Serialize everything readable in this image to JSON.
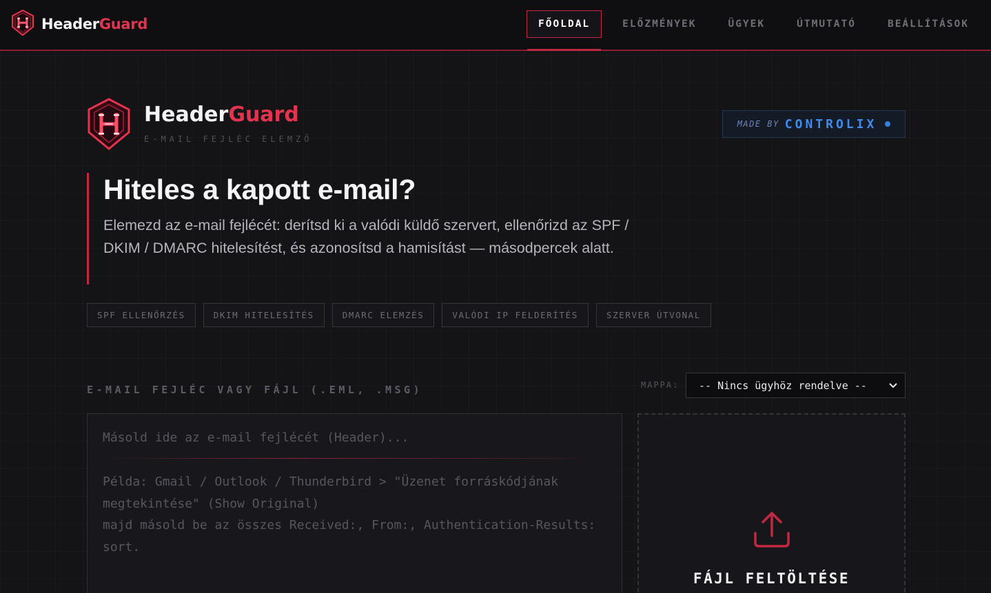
{
  "brand": {
    "name_white": "Header",
    "name_red": "Guard"
  },
  "nav": {
    "items": [
      {
        "label": "FŐOLDAL",
        "active": true
      },
      {
        "label": "ELŐZMÉNYEK",
        "active": false
      },
      {
        "label": "ÜGYEK",
        "active": false
      },
      {
        "label": "ÚTMUTATÓ",
        "active": false
      },
      {
        "label": "BEÁLLÍTÁSOK",
        "active": false
      }
    ]
  },
  "hero": {
    "title_white": "Header",
    "title_red": "Guard",
    "subtitle": "E-MAIL FEJLÉC ELEMZŐ"
  },
  "made_by": {
    "prefix": "MADE BY",
    "company": "CONTROLIX"
  },
  "lede": {
    "heading": "Hiteles a kapott e-mail?",
    "text": "Elemezd az e-mail fejlécét: derítsd ki a valódi küldő szervert, ellenőrizd az SPF / DKIM / DMARC hitelesítést, és azonosítsd a hamisítást — másodpercek alatt."
  },
  "tags": [
    "SPF ELLENŐRZÉS",
    "DKIM HITELESÍTÉS",
    "DMARC ELEMZÉS",
    "VALÓDI IP FELDERÍTÉS",
    "SZERVER ÚTVONAL"
  ],
  "input_section": {
    "label": "E-MAIL FEJLÉC VAGY FÁJL (.EML, .MSG)",
    "folder_label": "MAPPA:",
    "folder_value": "-- Nincs ügyhöz rendelve --",
    "placeholder_main": "Másold ide az e-mail fejlécét (Header)...",
    "placeholder_hint": "Példa: Gmail / Outlook / Thunderbird > \"Üzenet forráskódjának megtekintése\" (Show Original)\nmajd másold be az összes Received:, From:, Authentication-Results: sort.",
    "upload_label": "FÁJL FELTÖLTÉSE"
  },
  "colors": {
    "accent": "#c32843",
    "brand_red": "#e2344f",
    "blue": "#3f8cf0"
  },
  "icons": {
    "brand": "shield-h-icon",
    "upload": "upload-icon",
    "select": "chevron-down-icon"
  }
}
